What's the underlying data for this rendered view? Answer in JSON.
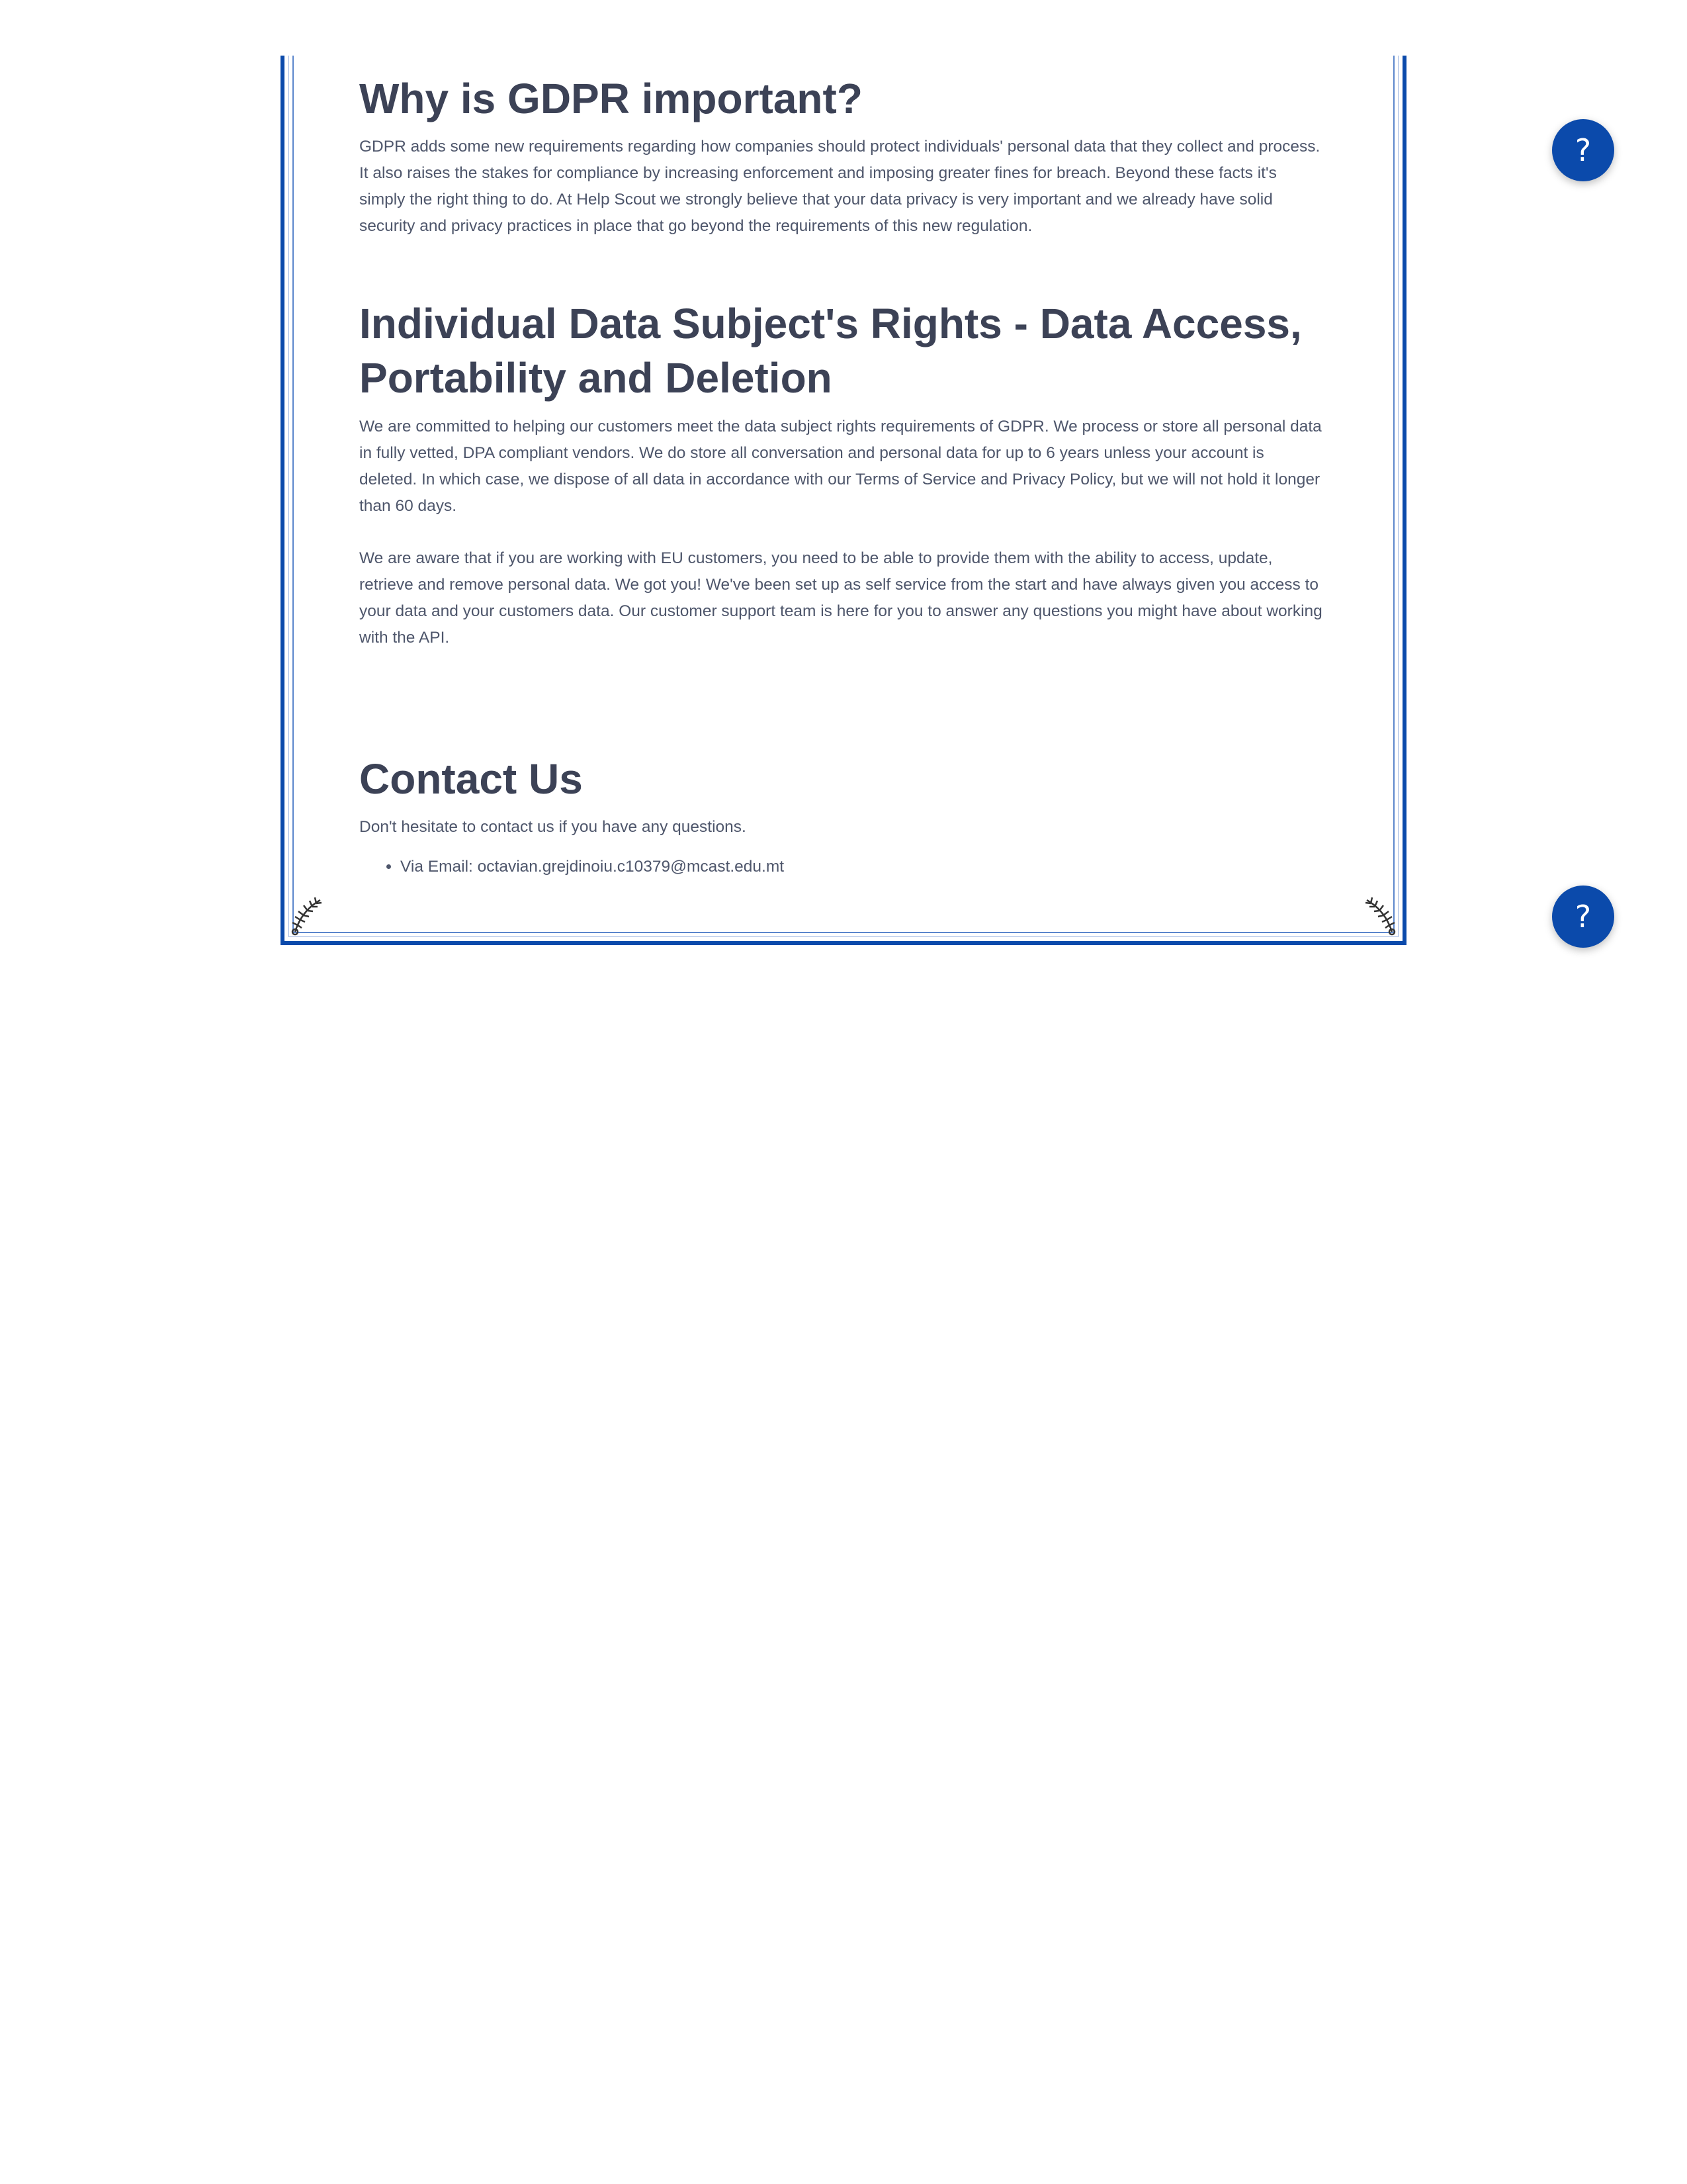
{
  "sections": {
    "why": {
      "title": "Why is GDPR important?",
      "body": "GDPR adds some new requirements regarding how companies should protect individuals' personal data that they collect and process. It also raises the stakes for compliance by increasing enforcement and imposing greater fines for breach. Beyond these facts it's simply the right thing to do. At Help Scout we strongly believe that your data privacy is very important and we already have solid security and privacy practices in place that go beyond the requirements of this new regulation."
    },
    "rights": {
      "title": "Individual Data Subject's Rights - Data Access, Portability and Deletion",
      "body1": "We are committed to helping our customers meet the data subject rights requirements of GDPR. We process or store all personal data in fully vetted, DPA compliant vendors. We do store all conversation and personal data for up to 6 years unless your account is deleted. In which case, we dispose of all data in accordance with our Terms of Service and Privacy Policy, but we will not hold it longer than 60 days.",
      "body2": "We are aware that if you are working with EU customers, you need to be able to provide them with the ability to access, update, retrieve and remove personal data. We got you! We've been set up as self service from the start and have always given you access to your data and your customers data. Our customer support team is here for you to answer any questions you might have about working with the API."
    },
    "contact": {
      "title": "Contact Us",
      "body": "Don't hesitate to contact us if you have any questions.",
      "items": [
        "Via Email: octavian.grejdinoiu.c10379@mcast.edu.mt"
      ]
    }
  },
  "help_button": {
    "label": "?"
  },
  "colors": {
    "accent": "#0b4aab",
    "heading": "#3c4256",
    "body": "#4e566b"
  },
  "icons": {
    "help": "question-mark-icon",
    "corner": "laurel-ornament-icon"
  }
}
